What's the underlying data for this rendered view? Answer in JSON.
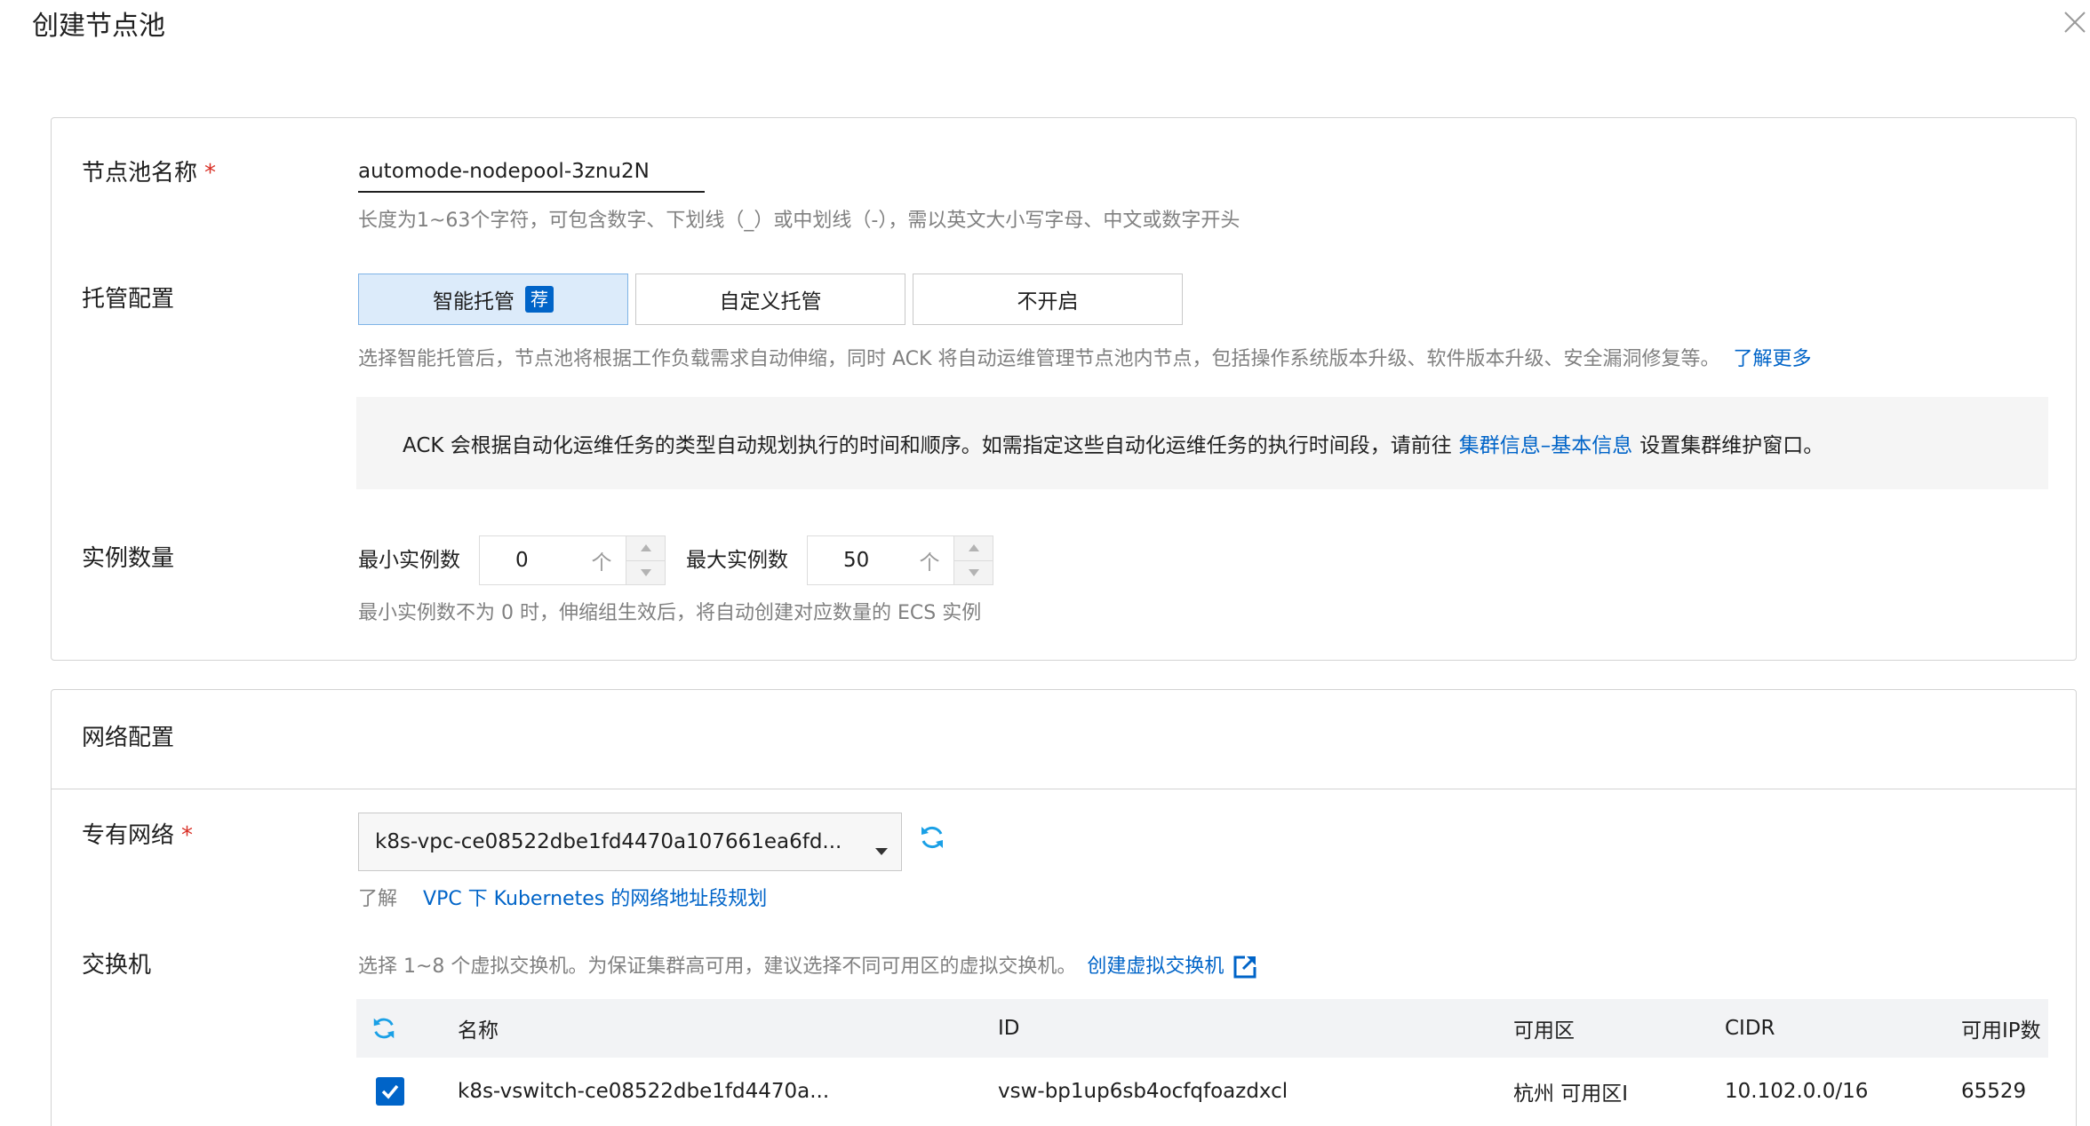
{
  "dialog": {
    "title": "创建节点池"
  },
  "basic": {
    "name_label": "节点池名称",
    "required_mark": "*",
    "name_value": "automode-nodepool-3znu2N",
    "name_hint": "长度为1~63个字符，可包含数字、下划线（_）或中划线（-），需以英文大小写字母、中文或数字开头",
    "managed_label": "托管配置",
    "managed_options": [
      {
        "label": "智能托管",
        "badge": "荐",
        "selected": true
      },
      {
        "label": "自定义托管",
        "selected": false
      },
      {
        "label": "不开启",
        "selected": false
      }
    ],
    "managed_hint": "选择智能托管后，节点池将根据工作负载需求自动伸缩，同时 ACK 将自动运维管理节点池内节点，包括操作系统版本升级、软件版本升级、安全漏洞修复等。",
    "learn_more": "了解更多",
    "notice_text": "ACK 会根据自动化运维任务的类型自动规划执行的时间和顺序。如需指定这些自动化运维任务的执行时间段，请前往",
    "notice_link": "集群信息–基本信息",
    "notice_tail": "设置集群维护窗口。",
    "instances_label": "实例数量",
    "min_label": "最小实例数",
    "min_value": "0",
    "max_label": "最大实例数",
    "max_value": "50",
    "unit": "个",
    "instances_hint": "最小实例数不为 0 时，伸缩组生效后，将自动创建对应数量的 ECS 实例"
  },
  "network": {
    "section_title": "网络配置",
    "vpc_label": "专有网络",
    "required_mark": "*",
    "vpc_value": "k8s-vpc-ce08522dbe1fd4470a107661ea6fd...",
    "vpc_hint_prefix": "了解",
    "vpc_hint_link": "VPC 下 Kubernetes 的网络地址段规划",
    "vswitch_label": "交换机",
    "vswitch_hint": "选择 1~8 个虚拟交换机。为保证集群高可用，建议选择不同可用区的虚拟交换机。",
    "create_vswitch": "创建虚拟交换机",
    "table": {
      "columns": [
        "名称",
        "ID",
        "可用区",
        "CIDR",
        "可用IP数"
      ],
      "rows": [
        {
          "checked": true,
          "name": "k8s-vswitch-ce08522dbe1fd4470a...",
          "id": "vsw-bp1up6sb4ocfqfoazdxcl",
          "zone": "杭州 可用区I",
          "cidr": "10.102.0.0/16",
          "ips": "65529"
        }
      ]
    }
  },
  "colors": {
    "accent": "#0064c8",
    "refresh": "#1aa0e6",
    "required": "#d93026"
  }
}
